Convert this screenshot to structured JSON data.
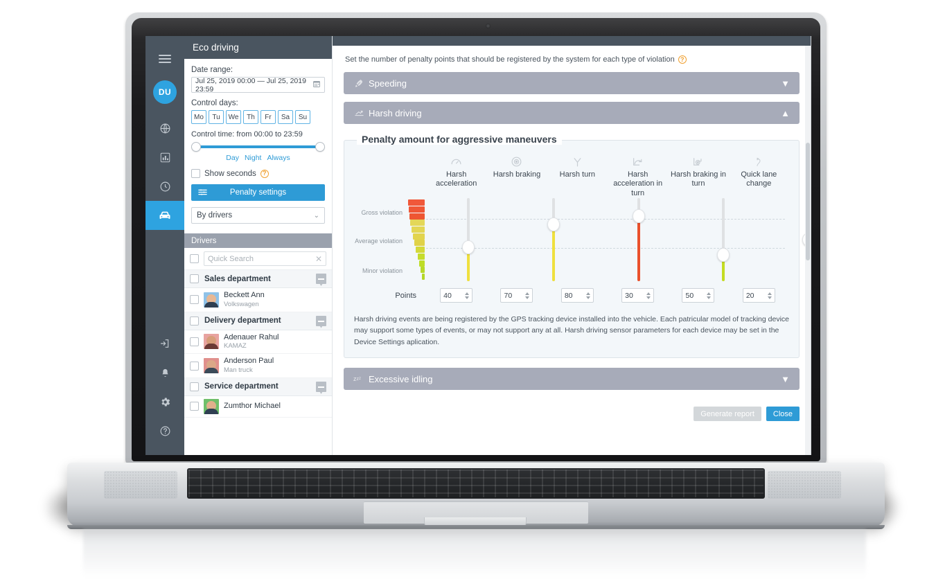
{
  "rail": {
    "menu_icon": "hamburger-icon",
    "avatar_initials": "DU",
    "items": [
      {
        "icon": "globe-icon",
        "name": "globe"
      },
      {
        "icon": "chart-icon",
        "name": "reports"
      },
      {
        "icon": "clock-icon",
        "name": "history"
      },
      {
        "icon": "car-icon",
        "name": "vehicles",
        "active": true
      }
    ],
    "bottom_items": [
      {
        "icon": "logout-icon",
        "name": "logout"
      },
      {
        "icon": "bell-icon",
        "name": "notifications"
      },
      {
        "icon": "gear-icon",
        "name": "settings"
      },
      {
        "icon": "help-icon",
        "name": "help"
      }
    ]
  },
  "left_panel": {
    "title": "Eco driving",
    "date_range_label": "Date range:",
    "date_range_value": "Jul 25, 2019 00:00 — Jul 25, 2019 23:59",
    "calendar_icon": "calendar-icon",
    "control_days_label": "Control days:",
    "days": [
      "Mo",
      "Tu",
      "We",
      "Th",
      "Fr",
      "Sa",
      "Su"
    ],
    "control_time_label": "Control time: from 00:00 to 23:59",
    "presets": [
      "Day",
      "Night",
      "Always"
    ],
    "show_seconds_label": "Show seconds",
    "help_icon": "question-icon",
    "penalty_settings_label": "Penalty settings",
    "penalty_icon": "sliders-icon",
    "group_by_value": "By drivers",
    "drivers_header": "Drivers",
    "search_placeholder": "Quick Search",
    "clear_icon": "close-icon",
    "groups": [
      {
        "name": "Sales department",
        "drivers": [
          {
            "name": "Beckett Ann",
            "vehicle": "Volkswagen",
            "avatar_bg": "#8fc2e8",
            "skin": "#e8b894",
            "shirt": "#2f3f52"
          }
        ]
      },
      {
        "name": "Delivery department",
        "drivers": [
          {
            "name": "Adenauer Rahul",
            "vehicle": "KAMAZ",
            "avatar_bg": "#e8a3a0",
            "skin": "#d79e7a",
            "shirt": "#6b3a35"
          },
          {
            "name": "Anderson Paul",
            "vehicle": "Man truck",
            "avatar_bg": "#e0908c",
            "skin": "#dba888",
            "shirt": "#3b4a58"
          }
        ]
      },
      {
        "name": "Service department",
        "drivers": [
          {
            "name": "Zumthor Michael",
            "vehicle": "",
            "avatar_bg": "#6fbf6a",
            "skin": "#e0b08c",
            "shirt": "#2f3f52"
          }
        ]
      }
    ]
  },
  "main": {
    "hint_text": "Set the number of penalty points that should be registered by the system for each type of violation",
    "hint_icon": "question-icon",
    "accordions": [
      {
        "label": "Speeding",
        "icon": "rocket-icon",
        "state": "collapsed",
        "chevron": "▼"
      },
      {
        "label": "Harsh driving",
        "icon": "harsh-driving-icon",
        "state": "expanded",
        "chevron": "▲"
      },
      {
        "label": "Excessive idling",
        "icon": "zzz-icon",
        "state": "collapsed",
        "chevron": "▼"
      }
    ],
    "fieldset_legend": "Penalty amount for aggressive maneuvers",
    "points_label": "Points",
    "scale_labels": [
      "Gross violation",
      "Average violation",
      "Minor violation"
    ],
    "description": "Harsh driving events are being registered by the GPS tracking device installed into the vehicle. Each patricular model of tracking device may support some types of events, or may not support any at all. Harsh driving sensor parameters for each device may be set in the Device Settings aplication.",
    "generate_report_label": "Generate report",
    "close_label": "Close"
  },
  "chart_data": {
    "type": "bar",
    "title": "Penalty amount for aggressive maneuvers",
    "xlabel": "",
    "ylabel": "Penalty points",
    "ylim": [
      0,
      100
    ],
    "categories": [
      "Harsh acceleration",
      "Harsh braking",
      "Harsh turn",
      "Harsh acceleration in turn",
      "Harsh braking in turn",
      "Quick lane change"
    ],
    "values": [
      40,
      70,
      80,
      30,
      50,
      20
    ],
    "icons": [
      "harsh-acceleration-icon",
      "harsh-braking-icon",
      "harsh-turn-icon",
      "harsh-acceleration-in-turn-icon",
      "harsh-braking-in-turn-icon",
      "quick-lane-change-icon"
    ],
    "fill_colors": [
      "#efe03e",
      "#efe03e",
      "#ea512c",
      "#c4dc22",
      "#efe03e",
      "#c4dc22"
    ],
    "gridlines": [
      {
        "label": "Gross violation",
        "value": 70
      },
      {
        "label": "Minor violation",
        "value": 40
      }
    ],
    "grid": true,
    "legend": "none",
    "severity_scale": [
      {
        "label": "Gross violation",
        "color": "#f0583a"
      },
      {
        "label": "Average violation",
        "color": "#e2d653"
      },
      {
        "label": "Minor violation",
        "color": "#b8d92a"
      }
    ]
  }
}
